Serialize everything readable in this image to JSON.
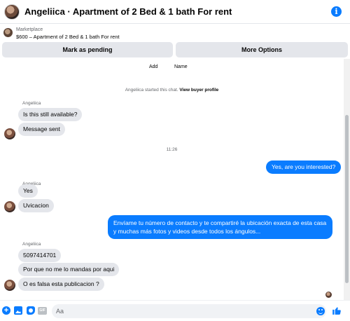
{
  "header": {
    "title": "Angeliica · Apartment of 2 Bed & 1 bath For rent",
    "info_icon": "info-icon",
    "info_glyph": "i"
  },
  "marketplace": {
    "label": "Marketplace",
    "listing": "$600 – Apartment of 2 Bed & 1 bath For rent"
  },
  "actions": {
    "mark_pending": "Mark as pending",
    "more_options": "More Options"
  },
  "chat": {
    "top_labels": {
      "add": "Add",
      "name": "Name"
    },
    "started_text": "Angeliica started this chat.",
    "view_profile": "View buyer profile",
    "groups": [
      {
        "sender": "Angeliica",
        "messages": [
          "Is this still available?",
          "Message sent"
        ]
      },
      {
        "sender": "Angeliica",
        "messages": [
          "Yes",
          "Uvicacion"
        ]
      },
      {
        "sender": "Angeliica",
        "messages": [
          "5097414701",
          "Por que no me lo mandas por aqui",
          "O es falsa esta publicacion ?"
        ]
      }
    ],
    "timestamp": "11:26",
    "outgoing": [
      "Yes, are you interested?",
      "Envíame tu número de contacto y te compartiré la ubicación exacta de esta casa y muchas más fotos y videos desde todos los ángulos..."
    ]
  },
  "composer": {
    "placeholder": "Aa",
    "gif_label": "GIF",
    "plus_glyph": "+"
  },
  "colors": {
    "accent": "#0a7cff",
    "incoming_bubble": "#e4e6eb",
    "secondary_text": "#65676b"
  }
}
